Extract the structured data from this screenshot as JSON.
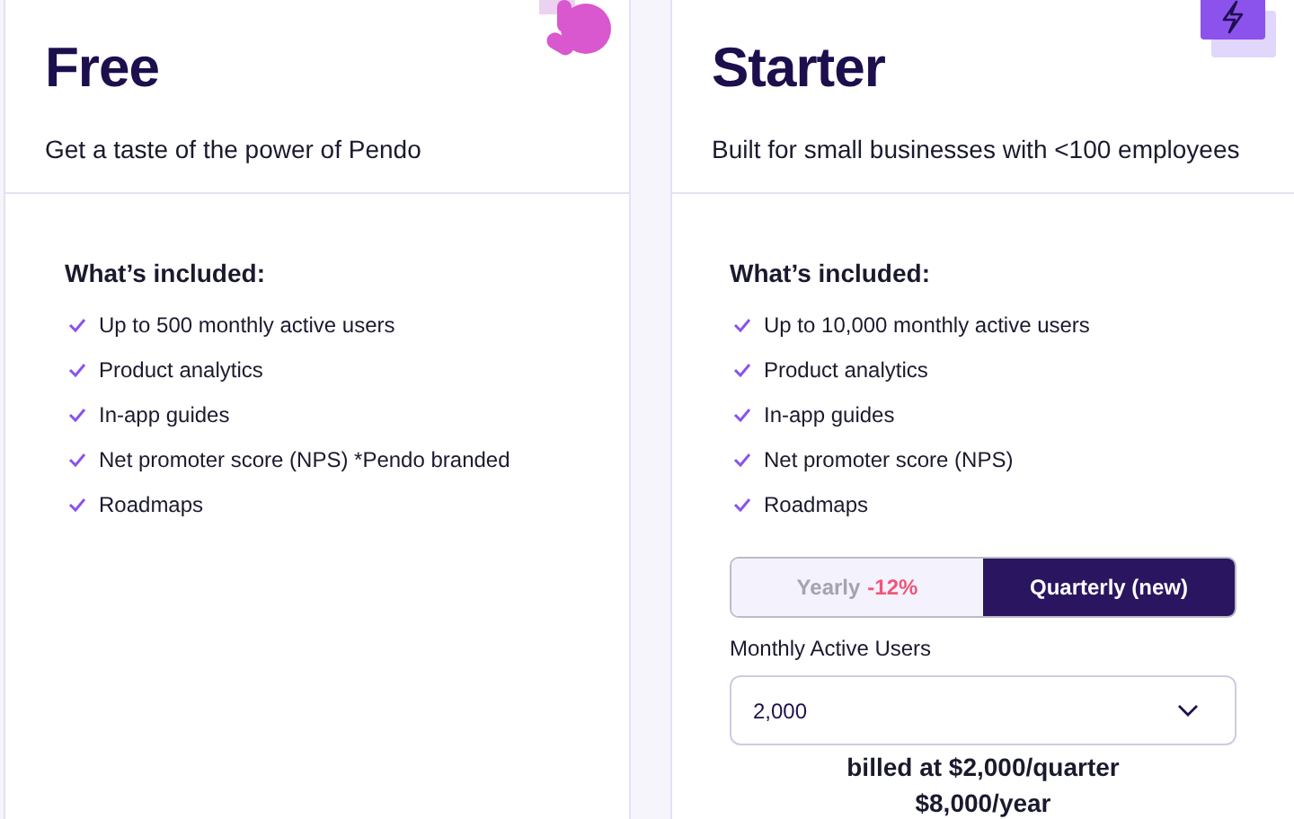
{
  "plans": [
    {
      "name": "Free",
      "tagline": "Get a taste of the power of Pendo",
      "included_heading": "What’s included:",
      "features": [
        "Up to 500 monthly active users",
        "Product analytics",
        "In-app guides",
        "Net promoter score (NPS) *Pendo branded",
        "Roadmaps"
      ]
    },
    {
      "name": "Starter",
      "tagline": "Built for small businesses with <100 employees",
      "included_heading": "What’s included:",
      "features": [
        "Up to 10,000 monthly active users",
        "Product analytics",
        "In-app guides",
        "Net promoter score (NPS)",
        "Roadmaps"
      ],
      "billing_options": [
        {
          "label": "Yearly",
          "discount": "-12%",
          "selected": false
        },
        {
          "label": "Quarterly (new)",
          "selected": true
        }
      ],
      "users_label": "Monthly Active Users",
      "users_value": "2,000",
      "billed": [
        "billed at $2,000/quarter",
        "$8,000/year"
      ]
    }
  ]
}
